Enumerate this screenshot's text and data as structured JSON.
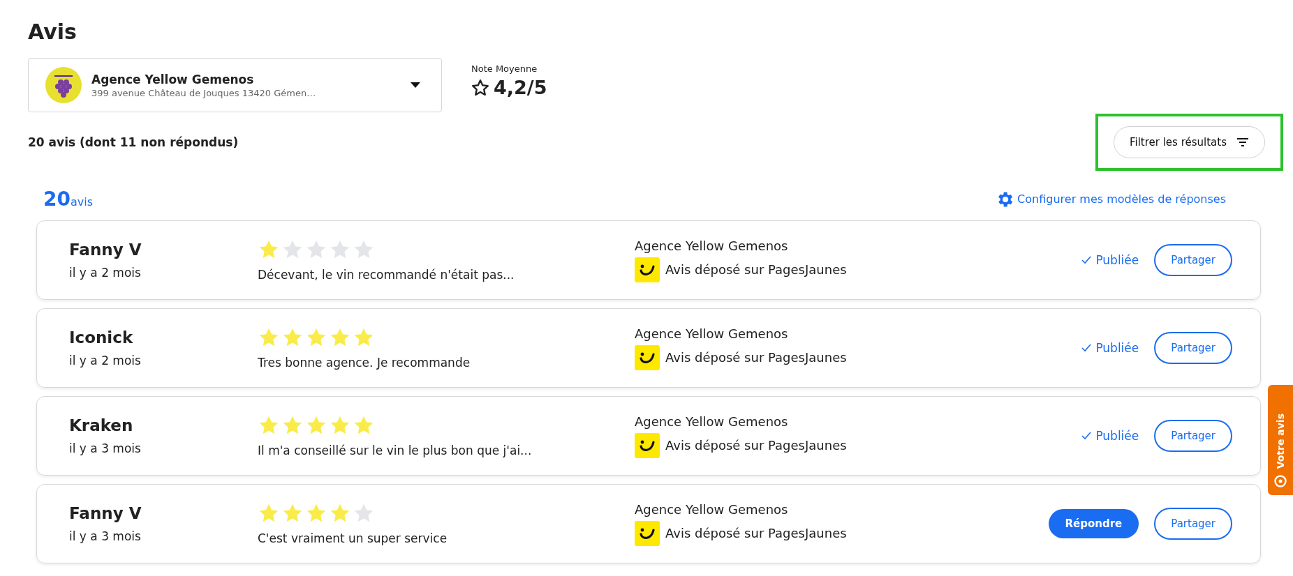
{
  "page_title": "Avis",
  "location": {
    "name": "Agence Yellow Gemenos",
    "address": "399 avenue Château de Jouques 13420 Gémen…"
  },
  "average": {
    "label": "Note Moyenne",
    "value": "4,2/5"
  },
  "summary": "20 avis (dont 11 non répondus)",
  "filter_button": {
    "label": "Filtrer les résultats",
    "highlighted": true
  },
  "count": {
    "number": "20",
    "unit": "avis"
  },
  "templates_link": "Configurer mes modèles de réponses",
  "reviews": [
    {
      "author": "Fanny V",
      "date": "il y a 2 mois",
      "stars": 1,
      "excerpt": "Décevant, le vin recommandé n'était pas...",
      "agency": "Agence Yellow Gemenos",
      "source": "Avis déposé sur PagesJaunes",
      "kind": "published",
      "status_label": "Publiée",
      "share": "Partager"
    },
    {
      "author": "Iconick",
      "date": "il y a 2 mois",
      "stars": 5,
      "excerpt": "Tres bonne agence. Je recommande",
      "agency": "Agence Yellow Gemenos",
      "source": "Avis déposé sur PagesJaunes",
      "kind": "published",
      "status_label": "Publiée",
      "share": "Partager"
    },
    {
      "author": "Kraken",
      "date": "il y a 3 mois",
      "stars": 5,
      "excerpt": "Il m'a conseillé sur le vin le plus bon que j'ai...",
      "agency": "Agence Yellow Gemenos",
      "source": "Avis déposé sur PagesJaunes",
      "kind": "published",
      "status_label": "Publiée",
      "share": "Partager"
    },
    {
      "author": "Fanny V",
      "date": "il y a 3 mois",
      "stars": 4,
      "excerpt": "C'est vraiment un super service",
      "agency": "Agence Yellow Gemenos",
      "source": "Avis déposé sur PagesJaunes",
      "kind": "reply",
      "status_label": "Répondre",
      "share": "Partager"
    }
  ],
  "feedback_tab": "Votre avis"
}
